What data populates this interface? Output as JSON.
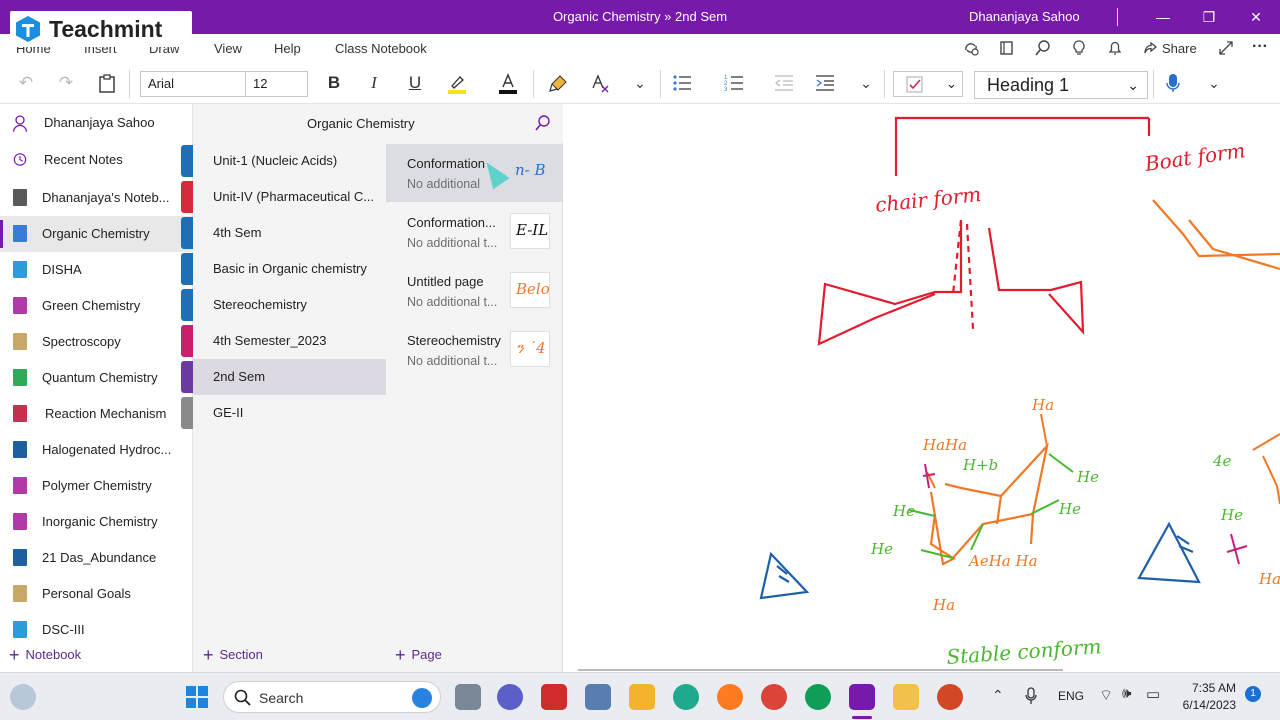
{
  "window": {
    "title": "Organic Chemistry » 2nd Sem",
    "user": "Dhananjaya Sahoo",
    "logo_text": "Teachmint"
  },
  "menu": {
    "items": [
      "Home",
      "Insert",
      "Draw",
      "View",
      "Help",
      "Class Notebook"
    ],
    "share_label": "Share"
  },
  "ribbon": {
    "font_name": "Arial",
    "font_size": "12",
    "style": "Heading 1"
  },
  "notebooks": {
    "user": "Dhananjaya Sahoo",
    "recent": "Recent Notes",
    "items": [
      {
        "label": "Dhananjaya's Noteb...",
        "color": "#5a5a5a"
      },
      {
        "label": "Organic Chemistry",
        "color": "#3a7bd5"
      },
      {
        "label": "DISHA",
        "color": "#2e9ad6"
      },
      {
        "label": "Green Chemistry",
        "color": "#b03aa7"
      },
      {
        "label": "Spectroscopy",
        "color": "#c8a868"
      },
      {
        "label": "Quantum Chemistry",
        "color": "#2eaa5a"
      },
      {
        "label": "Reaction Mechanism",
        "color": "#c83050"
      },
      {
        "label": "Halogenated Hydroc...",
        "color": "#1f5f9e"
      },
      {
        "label": "Polymer Chemistry",
        "color": "#b03aa7"
      },
      {
        "label": "Inorganic Chemistry",
        "color": "#b03aa7"
      },
      {
        "label": "21 Das_Abundance",
        "color": "#1f5f9e"
      },
      {
        "label": "Personal Goals",
        "color": "#c8a868"
      },
      {
        "label": "DSC-III",
        "color": "#2e9ad6"
      }
    ],
    "add_label": "Notebook"
  },
  "sections": {
    "header": "Organic Chemistry",
    "items": [
      {
        "label": "Unit-1 (Nucleic Acids)",
        "color": "#1f6fb5"
      },
      {
        "label": "Unit-IV (Pharmaceutical C...",
        "color": "#d62b3a"
      },
      {
        "label": "4th Sem",
        "color": "#1f6fb5"
      },
      {
        "label": "Basic in Organic chemistry",
        "color": "#1f6fb5"
      },
      {
        "label": "Stereochemistry",
        "color": "#1f6fb5"
      },
      {
        "label": "4th Semester_2023",
        "color": "#c8206a"
      },
      {
        "label": "2nd Sem",
        "color": "#6a3a9e"
      },
      {
        "label": "GE-II",
        "color": "#8a8a8a"
      }
    ],
    "add_label": "Section"
  },
  "pages": {
    "items": [
      {
        "title": "Conformation",
        "subtitle": "No additional",
        "thumb": "n- B",
        "thumb_color": "#2a6fd0"
      },
      {
        "title": "Conformation...",
        "subtitle": "No additional t...",
        "thumb": "E-IL",
        "thumb_color": "#111111"
      },
      {
        "title": "Untitled page",
        "subtitle": "No additional t...",
        "thumb": "Belo",
        "thumb_color": "#ef7a2a"
      },
      {
        "title": "Stereochemistry",
        "subtitle": "No additional t...",
        "thumb": "ን ˙4",
        "thumb_color": "#ef7a2a"
      }
    ],
    "add_label": "Page"
  },
  "canvas": {
    "ink_red_1": "chair form",
    "ink_red_2": "Boat form",
    "ink_green_1": "Stable conform",
    "ink_labels": [
      "Ha",
      "HaHa",
      "H+b",
      "He",
      "He",
      "He",
      "He",
      "AeHa Ha",
      "Ha",
      "4e",
      "He",
      "Ha"
    ]
  },
  "taskbar": {
    "search": "Search",
    "lang": "ENG",
    "time": "7:35 AM",
    "date": "6/14/2023",
    "badge": "1"
  }
}
